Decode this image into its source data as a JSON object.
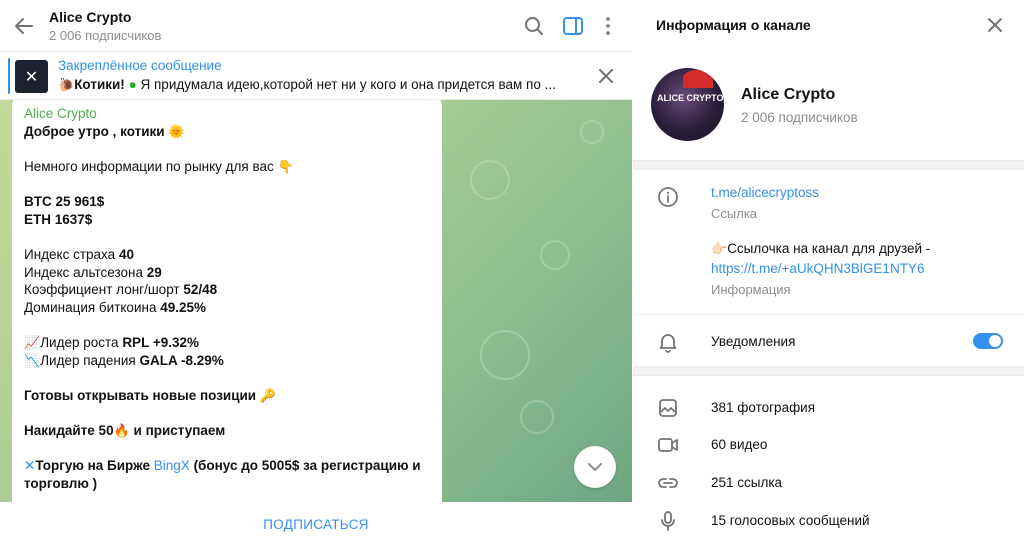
{
  "header": {
    "title": "Alice Crypto",
    "subtitle": "2 006 подписчиков"
  },
  "pinned": {
    "title": "Закреплённое сообщение",
    "thumb_glyph": "✕",
    "text_bold": "Котики!",
    "text": "Я придумала идею,которой нет ни у кого и она придется вам по ..."
  },
  "message": {
    "author": "Alice Crypto",
    "greeting": "Доброе утро , котики",
    "intro": "Немного информации  по рынку для вас",
    "btc": "BTC 25 961$",
    "eth": "ETH 1637$",
    "fear_label": "Индекс страха",
    "fear_value": "40",
    "altseason_label": "Индекс альтсезона",
    "altseason_value": "29",
    "ls_label": "Коэффициент лонг/шорт",
    "ls_value": "52/48",
    "dom_label": "Доминация биткоина",
    "dom_value": "49.25%",
    "leader_up_label": "Лидер роста",
    "leader_up_value": "RPL +9.32%",
    "leader_down_label": "Лидер падения",
    "leader_down_value": "GALA -8.29%",
    "ready": "Готовы открывать новые позиции",
    "tap_prefix": "Накидайте 50",
    "tap_suffix": "и приступаем",
    "trade_prefix": "Торгую на Бирже",
    "trade_link": "BingX",
    "trade_suffix": "(бонус до 5005$ за регистрацию и",
    "trade_line2": "торговлю )"
  },
  "subscribe_label": "ПОДПИСАТЬСЯ",
  "info": {
    "title": "Информация о канале",
    "name": "Alice Crypto",
    "subs": "2 006 подписчиков",
    "avatar_text": "ALICE CRYPTO",
    "link": "t.me/alicecryptoss",
    "link_label": "Ссылка",
    "desc_text": "Ссылочка  на канал для друзей -",
    "desc_link": "https://t.me/+aUkQHN3BlGE1NTY6",
    "desc_label": "Информация",
    "notif_label": "Уведомления",
    "notif_on": true,
    "photos": "381 фотография",
    "videos": "60 видео",
    "links": "251 ссылка",
    "voice": "15 голосовых сообщений"
  }
}
